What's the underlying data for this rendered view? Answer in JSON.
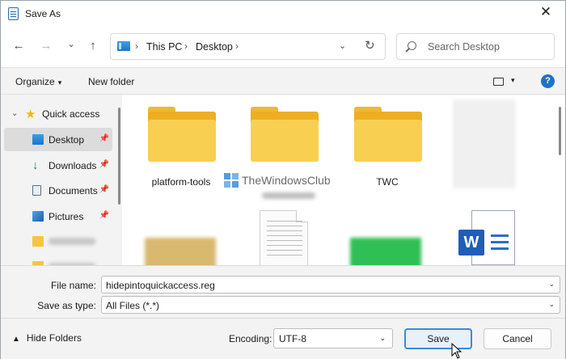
{
  "window": {
    "title": "Save As",
    "close_glyph": "✕"
  },
  "nav": {
    "back_glyph": "←",
    "forward_glyph": "→",
    "recent_glyph": "⌄",
    "up_glyph": "↑",
    "breadcrumb": [
      "This PC",
      "Desktop"
    ],
    "refresh_glyph": "↻",
    "search_placeholder": "Search Desktop"
  },
  "commandbar": {
    "organize": "Organize",
    "new_folder": "New folder",
    "help": "?"
  },
  "sidebar": {
    "items": [
      {
        "label": "Quick access",
        "icon": "star-icon"
      },
      {
        "label": "Desktop",
        "icon": "desktop-icon",
        "pinned": true,
        "selected": true
      },
      {
        "label": "Downloads",
        "icon": "download-icon",
        "pinned": true
      },
      {
        "label": "Documents",
        "icon": "documents-icon",
        "pinned": true
      },
      {
        "label": "Pictures",
        "icon": "pictures-icon",
        "pinned": true
      }
    ]
  },
  "content": {
    "items": [
      {
        "label": "platform-tools",
        "type": "folder"
      },
      {
        "label": "TheWindowsClub",
        "type": "watermark"
      },
      {
        "label": "TWC",
        "type": "folder"
      }
    ]
  },
  "form": {
    "filename_label": "File name:",
    "filename_value": "hidepintoquickaccess.reg",
    "savetype_label": "Save as type:",
    "savetype_value": "All Files  (*.*)"
  },
  "footer": {
    "hide_folders": "Hide Folders",
    "encoding_label": "Encoding:",
    "encoding_value": "UTF-8",
    "save": "Save",
    "cancel": "Cancel"
  },
  "colors": {
    "accent": "#3b8ad9",
    "folder": "#f9cf52",
    "star": "#f2b800"
  }
}
